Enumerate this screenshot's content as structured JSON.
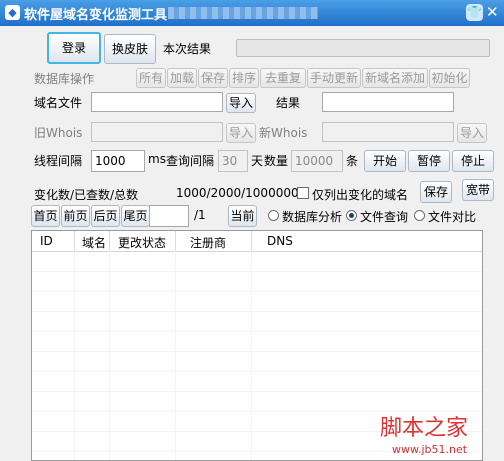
{
  "window": {
    "title": "软件屋域名变化监测工具",
    "icons": {
      "app": "app-icon",
      "skin": "skin-shirt-icon",
      "close": "close-icon"
    }
  },
  "toolbar": {
    "login_label": "登录",
    "skin_label": "换皮肤",
    "current_result_label": "本次结果",
    "progress_value": 0.0
  },
  "db_ops": {
    "label": "数据库操作",
    "buttons": [
      "所有",
      "加载",
      "保存",
      "排序",
      "去重复",
      "手动更新",
      "新域名添加",
      "初始化"
    ]
  },
  "domain_file": {
    "label": "域名文件",
    "value": "",
    "import_label": "导入"
  },
  "result": {
    "label": "结果",
    "value": ""
  },
  "old_whois": {
    "label": "旧Whois",
    "value": "",
    "import_label": "导入"
  },
  "new_whois": {
    "label": "新Whois",
    "value": "",
    "import_label": "导入"
  },
  "timing": {
    "thread_interval_label": "线程间隔",
    "thread_interval_value": "1000",
    "ms_label": "ms",
    "query_interval_label": "查询间隔",
    "query_interval_value": "30",
    "days_label": "天",
    "count_label": "数量",
    "count_value": "10000",
    "count_unit": "条"
  },
  "controls": {
    "start_label": "开始",
    "pause_label": "暂停",
    "stop_label": "停止",
    "save_label": "保存",
    "broadband_label": "宽带"
  },
  "stats": {
    "label": "变化数/已查数/总数",
    "value": "1000/2000/1000000",
    "only_changed_label": "仅列出变化的域名"
  },
  "paging": {
    "first_label": "首页",
    "prev_label": "前页",
    "next_label": "后页",
    "last_label": "尾页",
    "page_value": "",
    "total_pages": "/1",
    "current_label": "当前"
  },
  "mode": {
    "options": [
      "数据库分析",
      "文件查询",
      "文件对比"
    ],
    "selected": "文件查询"
  },
  "table": {
    "columns": [
      "ID",
      "域名",
      "更改状态",
      "注册商",
      "DNS"
    ]
  },
  "watermark": {
    "text": "脚本之家",
    "url": "www.jb51.net"
  }
}
